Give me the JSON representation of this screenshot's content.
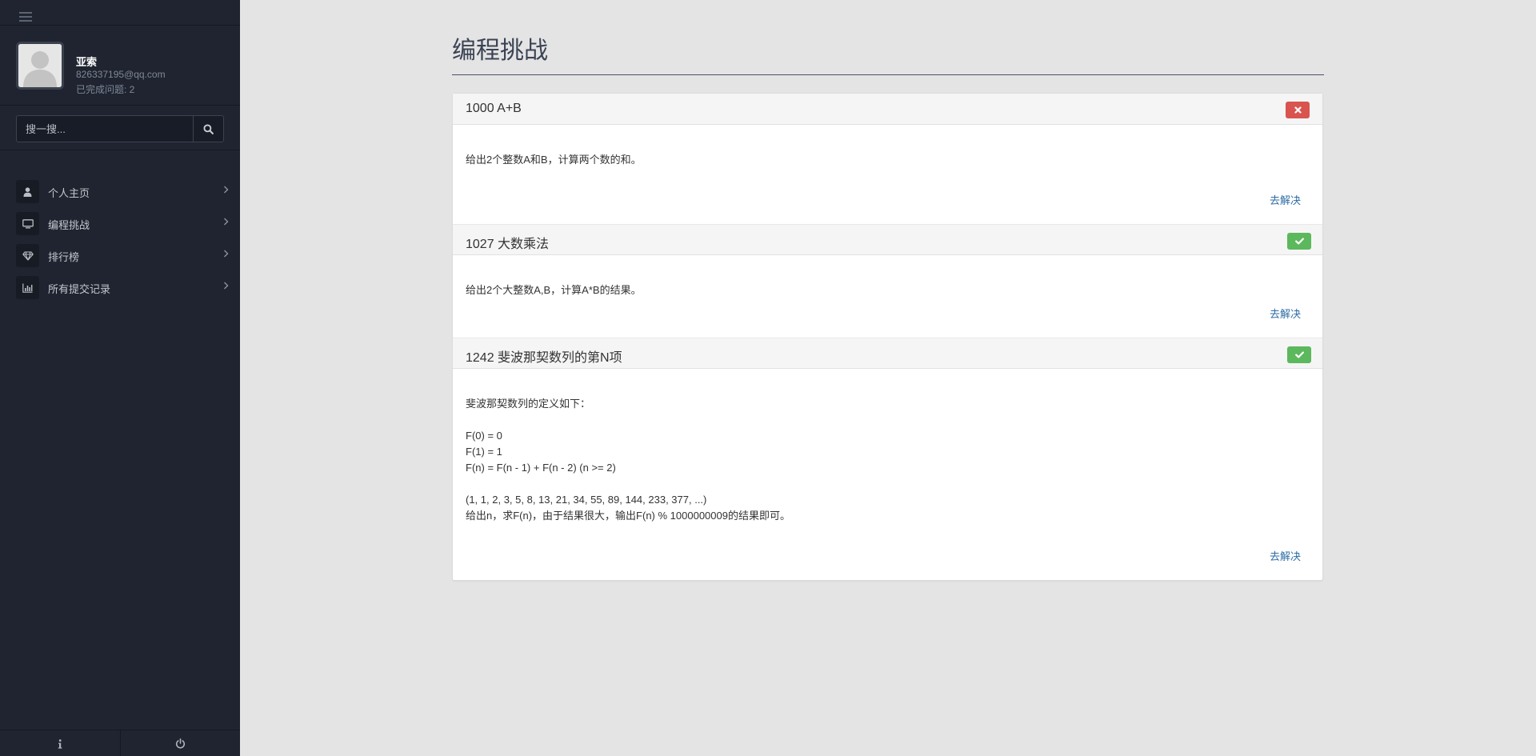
{
  "user": {
    "name": "亚索",
    "email": "826337195@qq.com",
    "completed": "已完成问题: 2"
  },
  "search": {
    "placeholder": "搜一搜..."
  },
  "nav": [
    {
      "label": "个人主页",
      "icon": "user-icon"
    },
    {
      "label": "编程挑战",
      "icon": "monitor-icon"
    },
    {
      "label": "排行榜",
      "icon": "diamond-icon"
    },
    {
      "label": "所有提交记录",
      "icon": "bar-chart-icon"
    }
  ],
  "footer": {
    "left_icon": "info-icon",
    "right_icon": "power-icon"
  },
  "page": {
    "title": "编程挑战"
  },
  "problems": [
    {
      "title": "1000 A+B",
      "status": "fail",
      "desc": [
        "给出2个整数A和B，计算两个数的和。"
      ],
      "action": "去解决"
    },
    {
      "title": "1027 大数乘法",
      "status": "ok",
      "desc": [
        "给出2个大整数A,B，计算A*B的结果。"
      ],
      "action": "去解决"
    },
    {
      "title": "1242 斐波那契数列的第N项",
      "status": "ok",
      "desc": [
        "斐波那契数列的定义如下：",
        "",
        "F(0) = 0",
        "F(1) = 1",
        "F(n) = F(n - 1) + F(n - 2) (n >= 2)",
        "",
        "(1, 1, 2, 3, 5, 8, 13, 21, 34, 55, 89, 144, 233, 377, ...)",
        "给出n，求F(n)，由于结果很大，输出F(n) % 1000000009的结果即可。"
      ],
      "action": "去解决"
    }
  ],
  "colors": {
    "sidebar": "#1f2430",
    "danger": "#d9534f",
    "success": "#5cb85c",
    "link": "#2e6da4"
  }
}
